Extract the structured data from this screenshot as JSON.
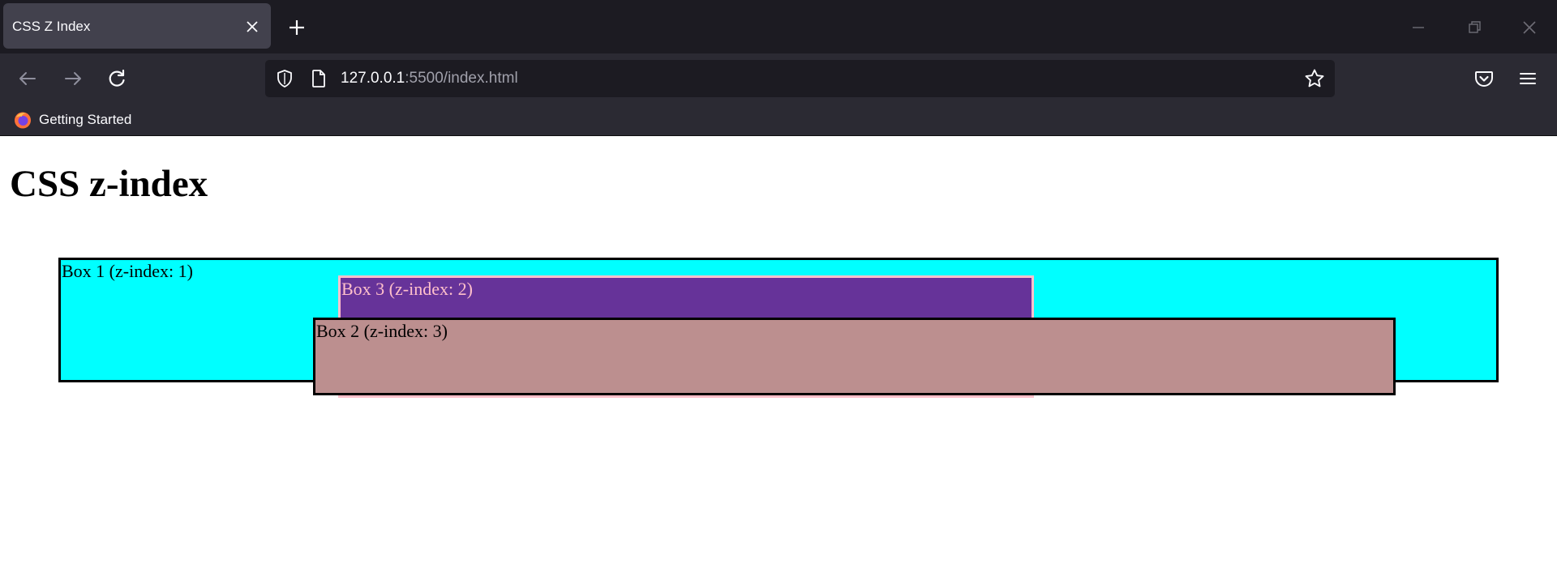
{
  "browser": {
    "tab_title": "CSS Z Index",
    "url_host": "127.0.0.1",
    "url_path": ":5500/index.html",
    "bookmark_label": "Getting Started",
    "icons": {
      "tab_close": "close-icon",
      "new_tab": "plus-icon",
      "minimize": "minimize-icon",
      "restore": "restore-icon",
      "close": "close-icon",
      "back": "arrow-left-icon",
      "forward": "arrow-right-icon",
      "reload": "reload-icon",
      "shield": "shield-icon",
      "page": "page-icon",
      "star": "star-icon",
      "pocket": "pocket-icon",
      "menu": "hamburger-menu-icon",
      "bookmark": "firefox-icon"
    },
    "colors": {
      "tabbar_bg": "#1c1b22",
      "toolbar_bg": "#2b2a33",
      "active_tab_bg": "#42414d",
      "urlbar_bg": "#1c1b22"
    }
  },
  "page": {
    "heading": "CSS z-index",
    "boxes": [
      {
        "label": "Box 1 (z-index: 1)",
        "z_index": 1,
        "background": "#00ffff",
        "border": "#000000",
        "text_color": "#000000"
      },
      {
        "label": "Box 3 (z-index: 2)",
        "z_index": 2,
        "background": "#663399",
        "border": "#ffc0cb",
        "text_color": "#ffc0cb"
      },
      {
        "label": "Box 2 (z-index: 3)",
        "z_index": 3,
        "background": "#bc8f8f",
        "border": "#000000",
        "text_color": "#000000"
      }
    ]
  }
}
